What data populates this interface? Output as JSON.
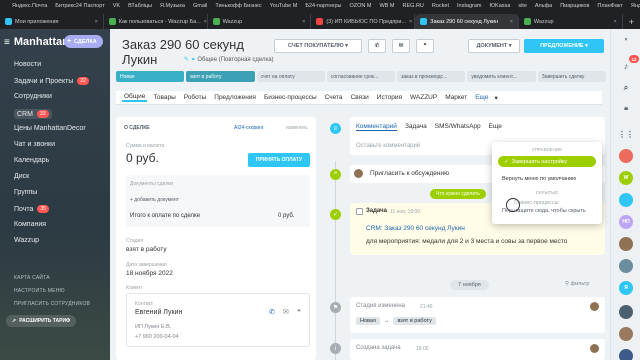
{
  "browser": {
    "bookmarks": [
      "Яндекс.Почта",
      "Битрикс24 Паспорт",
      "VK",
      "ВТабліцы",
      "Я.Музыка",
      "Gmail",
      "Тинькофф Бизнес",
      "YouTube M",
      "Б24-партнеры",
      "OZON M",
      "WB M",
      "REG.RU",
      "Rocket",
      "Instagram",
      "ЮKassa",
      "site",
      "Альфа",
      "Пиарщиков",
      "ПланФакт",
      "Яндекс"
    ],
    "tabs": [
      {
        "label": "Мои приложения",
        "active": false
      },
      {
        "label": "Как пользоваться - Wazzup Ба...",
        "active": false
      },
      {
        "label": "Wazzup",
        "active": false
      },
      {
        "label": "(3) ИП КИБЬЮС ПО Предпри...",
        "active": false
      },
      {
        "label": "Заказ 290 60 секунд Лукин",
        "active": true
      },
      {
        "label": "Wazzup",
        "active": false
      }
    ],
    "new_tab": "+"
  },
  "sidebar": {
    "portal_name": "Manhattan",
    "create_deal": "СДЕЛКА",
    "items": [
      {
        "label": "Новости",
        "badge": ""
      },
      {
        "label": "Задачи и Проекты",
        "badge": "22"
      },
      {
        "label": "Сотрудники",
        "badge": ""
      },
      {
        "label": "CRM",
        "badge": "33"
      },
      {
        "label": "Цены ManhattanDecor",
        "badge": ""
      },
      {
        "label": "Чат и звонки",
        "badge": ""
      },
      {
        "label": "Календарь",
        "badge": ""
      },
      {
        "label": "Диск",
        "badge": ""
      },
      {
        "label": "Группы",
        "badge": ""
      },
      {
        "label": "Почта",
        "badge": "35"
      },
      {
        "label": "Компания",
        "badge": ""
      },
      {
        "label": "Wazzup",
        "badge": ""
      }
    ],
    "more": "Ещё",
    "site_map": "КАРТА САЙТА",
    "setup_menu": "НАСТРОИТЬ МЕНЮ",
    "invite": "ПРИГЛАСИТЬ СОТРУДНИКОВ",
    "upgrade": "РАСШИРИТЬ ТАРИФ"
  },
  "deal": {
    "title_line1": "Заказ 290 60 секунд",
    "title_line2": "Лукин",
    "subtitle": "Общее (Повторная сделка)",
    "invoice_btn": "СЧЕТ ПОКУПАТЕЛЮ",
    "document_btn": "ДОКУМЕНТ",
    "offer_btn": "ПРЕДЛОЖЕНИЕ"
  },
  "stages": [
    {
      "label": "Новая",
      "color": "#37b0c8",
      "text": "#fff"
    },
    {
      "label": "взят в работу",
      "color": "#3da1b5",
      "text": "#fff"
    },
    {
      "label": "счет на оплату",
      "color": "#dfe5e8",
      "text": "#535c69"
    },
    {
      "label": "согласование срок...",
      "color": "#dfe5e8",
      "text": "#535c69"
    },
    {
      "label": "заказ в производс...",
      "color": "#dfe5e8",
      "text": "#535c69"
    },
    {
      "label": "уведомить клиент...",
      "color": "#dfe5e8",
      "text": "#535c69"
    },
    {
      "label": "Завершить сделку",
      "color": "#dfe5e8",
      "text": "#535c69"
    }
  ],
  "detail_tabs": [
    {
      "label": "Общие",
      "active": true
    },
    {
      "label": "Товары",
      "active": false
    },
    {
      "label": "Роботы",
      "active": false
    },
    {
      "label": "Предложения",
      "active": false
    },
    {
      "label": "Бизнес-процессы",
      "active": false
    },
    {
      "label": "Счета",
      "active": false
    },
    {
      "label": "Связи",
      "active": false
    },
    {
      "label": "История",
      "active": false
    },
    {
      "label": "WAZZUP",
      "active": false
    },
    {
      "label": "Маркет",
      "active": false
    },
    {
      "label": "Еще",
      "active": false
    }
  ],
  "about": {
    "header": "О СДЕЛКЕ",
    "ai_scoring": "AI24-скоринг",
    "edit": "изменить",
    "amount_label": "Сумма и валюта",
    "amount": "0 руб.",
    "pay_btn": "ПРИНЯТЬ ОПЛАТУ",
    "docs_label": "Документы сделки",
    "add_doc": "+ добавить документ",
    "total_label": "Итого к оплате по сделке",
    "total": "0 руб.",
    "stage_label": "Стадия",
    "stage_value": "взят в работу",
    "date_label": "Дата завершения",
    "date_value": "18 ноября 2022",
    "client_label": "Клиент",
    "contact_label": "Контакт",
    "contact_name": "Евгений Лукин",
    "contact_company": "ИП Лукин Е.В.",
    "contact_phone": "+7 960 200-04-04"
  },
  "timeline": {
    "tabs": [
      "Комментарий",
      "Задача",
      "SMS/WhatsApp",
      "Еще"
    ],
    "comment_placeholder": "Оставьте комментарий",
    "invite_text": "Пригласить к обсуждению",
    "needs_done": "Что нужно сделать",
    "task_title": "Задача",
    "task_date": "11 ноя, 19:00",
    "task_link": "CRM: Заказ 290 60 секунд Лукин",
    "task_desc": "для мероприятия: медали для 2 и 3 места и совы за первое место",
    "date_chip": "7 ноября",
    "filter": "фильтр",
    "stage_changed": "Стадия изменена",
    "stage_time": "21:46",
    "stage_from": "Новая",
    "stage_to": "взят в работу",
    "created_task": "Создана задача",
    "created_time": "19:06",
    "created_link": "CRM: Заказ 290 60 секунд Лукин",
    "created_desc": "для мероприятия: медали для 2 и 3 места и совы за первое место"
  },
  "popup": {
    "section_manage": "УПРАВЛЕНИЕ",
    "finish_setup": "Завершить настройку",
    "reset_menu": "Вернуть меню по умолчанию",
    "section_hidden": "СКРЫТЫЕ",
    "hidden_item": "Бизнес-процессы",
    "hint": "Перетащите сюда, чтобы скрыть"
  },
  "rightbar": {
    "badge_count": "12",
    "initials_w": "W",
    "initials_np": "НП",
    "initials_y": "Я"
  },
  "colors": {
    "accent": "#2fc6f6",
    "success": "#9dcf00",
    "danger": "#ff5752",
    "link": "#2067b0"
  }
}
